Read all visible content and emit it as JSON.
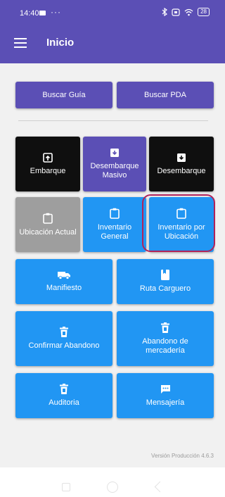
{
  "status_bar": {
    "time": "14:40",
    "dots": "···",
    "battery": "28"
  },
  "app_bar": {
    "title": "Inicio"
  },
  "top_buttons": {
    "buscar_guia": "Buscar Guía",
    "buscar_pda": "Buscar PDA"
  },
  "grid": {
    "embarque": "Embarque",
    "desembarque_masivo": "Desembarque Masivo",
    "desembarque": "Desembarque",
    "ubicacion_actual": "Ubicación Actual",
    "inventario_general": "Inventario General",
    "inventario_por_ubicacion": "Inventario por Ubicación",
    "manifiesto": "Manifiesto",
    "ruta_carguero": "Ruta Carguero",
    "confirmar_abandono": "Confirmar Abandono",
    "abandono_mercaderia": "Abandono de mercadería",
    "auditoria": "Auditoria",
    "mensajeria": "Mensajería"
  },
  "footer": {
    "version": "Versión Producción 4.6.3"
  },
  "colors": {
    "primary": "#5b4fb5",
    "blue": "#2196f3",
    "black": "#0f0f0f",
    "gray": "#9e9e9e",
    "highlight": "#b0235a"
  },
  "icons": {
    "embarque": "open-in-box-icon",
    "desembarque_masivo": "archive-icon",
    "desembarque": "archive-icon",
    "ubicacion_actual": "clipboard-icon",
    "inventario_general": "clipboard-icon",
    "inventario_por_ubicacion": "clipboard-icon",
    "manifiesto": "truck-icon",
    "ruta_carguero": "book-icon",
    "confirmar_abandono": "trash-icon",
    "abandono_mercaderia": "trash-icon",
    "auditoria": "trash-icon",
    "mensajeria": "chat-icon"
  }
}
